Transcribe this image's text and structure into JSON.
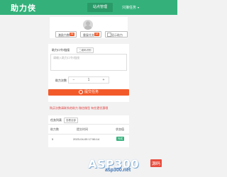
{
  "header": {
    "logo": "助力侠",
    "nav_active": "站点管理",
    "nav_item": "只接任务",
    "caret": "▾"
  },
  "actions": {
    "btn1": {
      "label": "激励力数",
      "badge": "36"
    },
    "btn2": {
      "label": "重复任务",
      "badge": "18"
    },
    "btn3": {
      "label": "显示助力"
    }
  },
  "form": {
    "link_label": "助力口令/链接",
    "tag": "二维码识别",
    "placeholder": "请输入助力口令/链接",
    "count_label": "助力次数",
    "minus": "−",
    "count_value": "1",
    "plus": "+",
    "submit": "提交任务",
    "warning": "购买次数请联系他助力 微信微型 有些更优惠哦"
  },
  "records": {
    "title": "任务列表",
    "tag": "查看全部",
    "columns": [
      "助力数",
      "提交时间",
      "状态值"
    ],
    "rows": [
      {
        "count": "5",
        "time": "2023-04-05 17:56:14",
        "status": "完成"
      }
    ]
  },
  "watermark": {
    "main": "ASP300",
    "tag": "源码",
    "url": "asp300.net"
  }
}
